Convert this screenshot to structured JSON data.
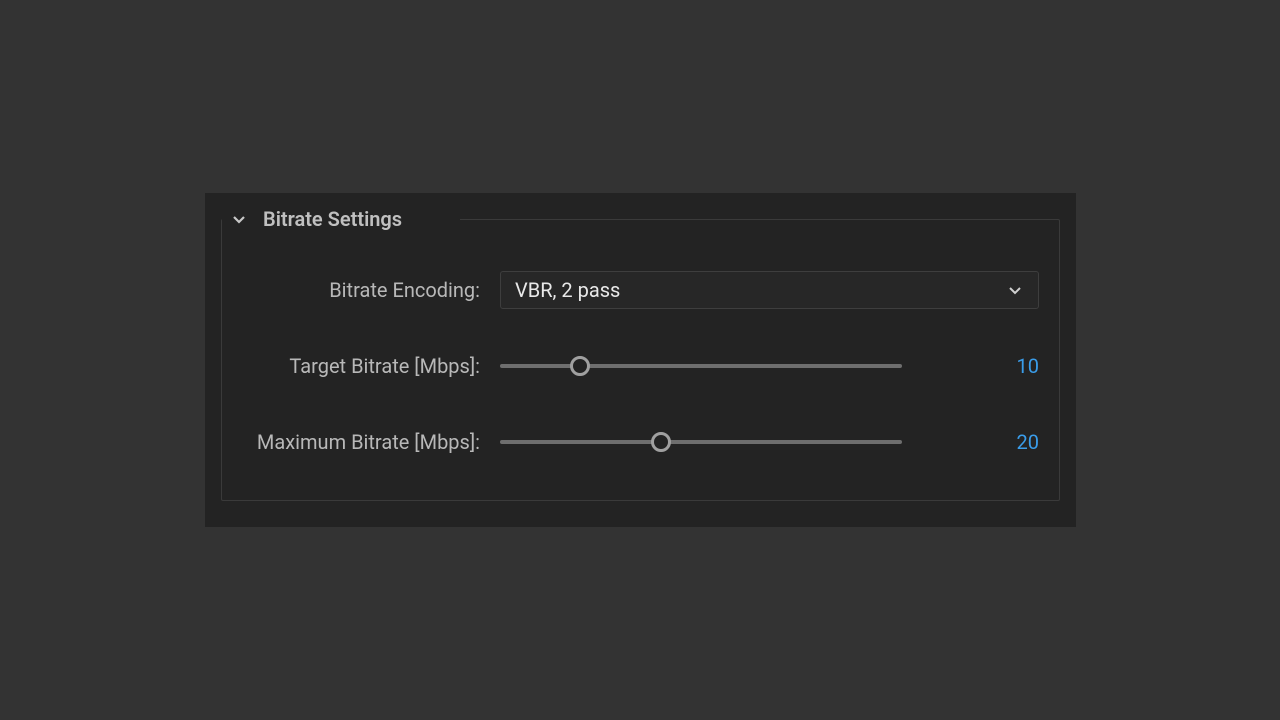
{
  "section": {
    "title": "Bitrate Settings"
  },
  "encoding": {
    "label": "Bitrate Encoding:",
    "value": "VBR, 2 pass"
  },
  "target": {
    "label": "Target Bitrate [Mbps]:",
    "value": "10",
    "thumb_pct": 20
  },
  "maximum": {
    "label": "Maximum Bitrate [Mbps]:",
    "value": "20",
    "thumb_pct": 40
  },
  "colors": {
    "accent_blue": "#3a9dea",
    "panel_bg": "#232323",
    "page_bg": "#333333"
  }
}
